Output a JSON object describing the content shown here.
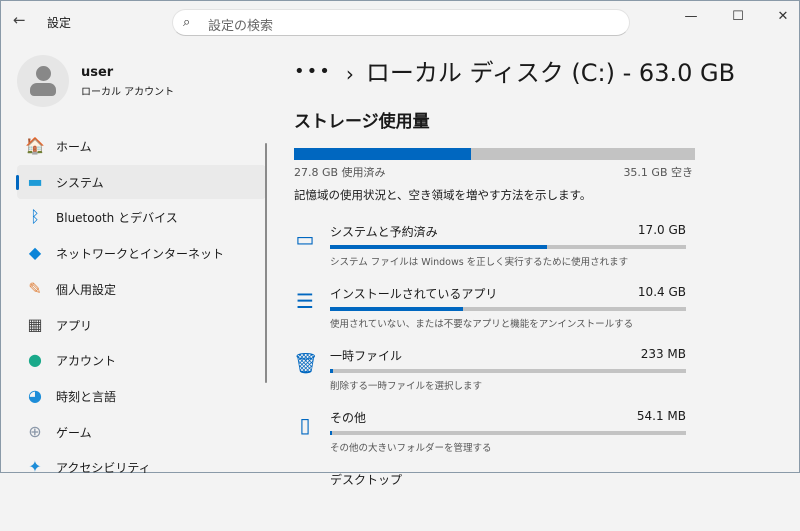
{
  "window": {
    "app_title": "設定",
    "search_placeholder": "設定の検索",
    "back_icon": "←",
    "minimize": "—",
    "maximize": "☐",
    "close": "✕"
  },
  "user": {
    "name": "user",
    "account_type": "ローカル アカウント"
  },
  "sidebar": {
    "items": [
      {
        "label": "ホーム",
        "icon": "🏠",
        "color": "#e8743b"
      },
      {
        "label": "システム",
        "icon": "▬",
        "color": "#1e9bd7",
        "selected": true
      },
      {
        "label": "Bluetooth とデバイス",
        "icon": "ᛒ",
        "color": "#0078d4"
      },
      {
        "label": "ネットワークとインターネット",
        "icon": "◆",
        "color": "#0a84d8"
      },
      {
        "label": "個人用設定",
        "icon": "✎",
        "color": "#e0803a"
      },
      {
        "label": "アプリ",
        "icon": "▦",
        "color": "#444"
      },
      {
        "label": "アカウント",
        "icon": "●",
        "color": "#1aa98a"
      },
      {
        "label": "時刻と言語",
        "icon": "◕",
        "color": "#1d8dd8"
      },
      {
        "label": "ゲーム",
        "icon": "⊕",
        "color": "#8a97a8"
      },
      {
        "label": "アクセシビリティ",
        "icon": "✦",
        "color": "#1d8dd8"
      }
    ]
  },
  "main": {
    "breadcrumb_more": "•••",
    "breadcrumb_sep": "›",
    "title": "ローカル ディスク (C:) - 63.0 GB",
    "section_title": "ストレージ使用量",
    "used_fraction": 0.441,
    "used_label": "27.8 GB 使用済み",
    "free_label": "35.1 GB 空き",
    "description": "記憶域の使用状況と、空き領域を増やす方法を示します。",
    "categories": [
      {
        "name": "システムと予約済み",
        "value": "17.0 GB",
        "fraction": 0.61,
        "sub": "システム ファイルは Windows を正しく実行するために使用されます",
        "icon": "▭"
      },
      {
        "name": "インストールされているアプリ",
        "value": "10.4 GB",
        "fraction": 0.374,
        "sub": "使用されていない、または不要なアプリと機能をアンインストールする",
        "icon": "☰"
      },
      {
        "name": "一時ファイル",
        "value": "233 MB",
        "fraction": 0.008,
        "sub": "削除する一時ファイルを選択します",
        "icon": "🗑"
      },
      {
        "name": "その他",
        "value": "54.1 MB",
        "fraction": 0.002,
        "sub": "その他の大きいフォルダーを管理する",
        "icon": "▯"
      },
      {
        "name": "デスクトップ",
        "value": "",
        "fraction": 0,
        "sub": "",
        "icon": ""
      }
    ]
  }
}
